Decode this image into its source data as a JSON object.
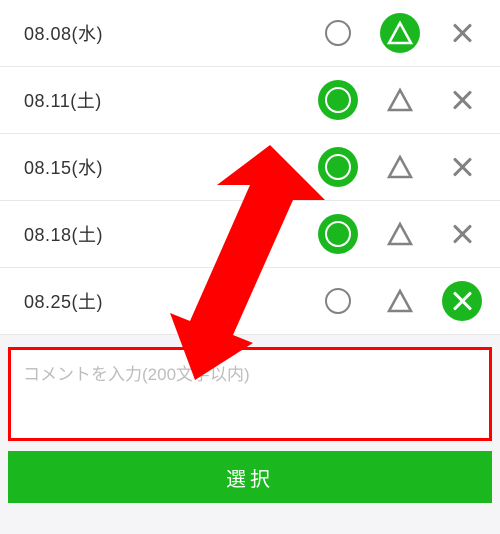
{
  "colors": {
    "accent": "#1BB71F",
    "highlight": "#ff0000"
  },
  "rows": [
    {
      "date": "08.08(水)",
      "selected": "triangle"
    },
    {
      "date": "08.11(土)",
      "selected": "circle"
    },
    {
      "date": "08.15(水)",
      "selected": "circle"
    },
    {
      "date": "08.18(土)",
      "selected": "circle"
    },
    {
      "date": "08.25(土)",
      "selected": "x"
    }
  ],
  "comment": {
    "placeholder": "コメントを入力(200文字以内)",
    "value": ""
  },
  "submit": {
    "label": "選択"
  }
}
